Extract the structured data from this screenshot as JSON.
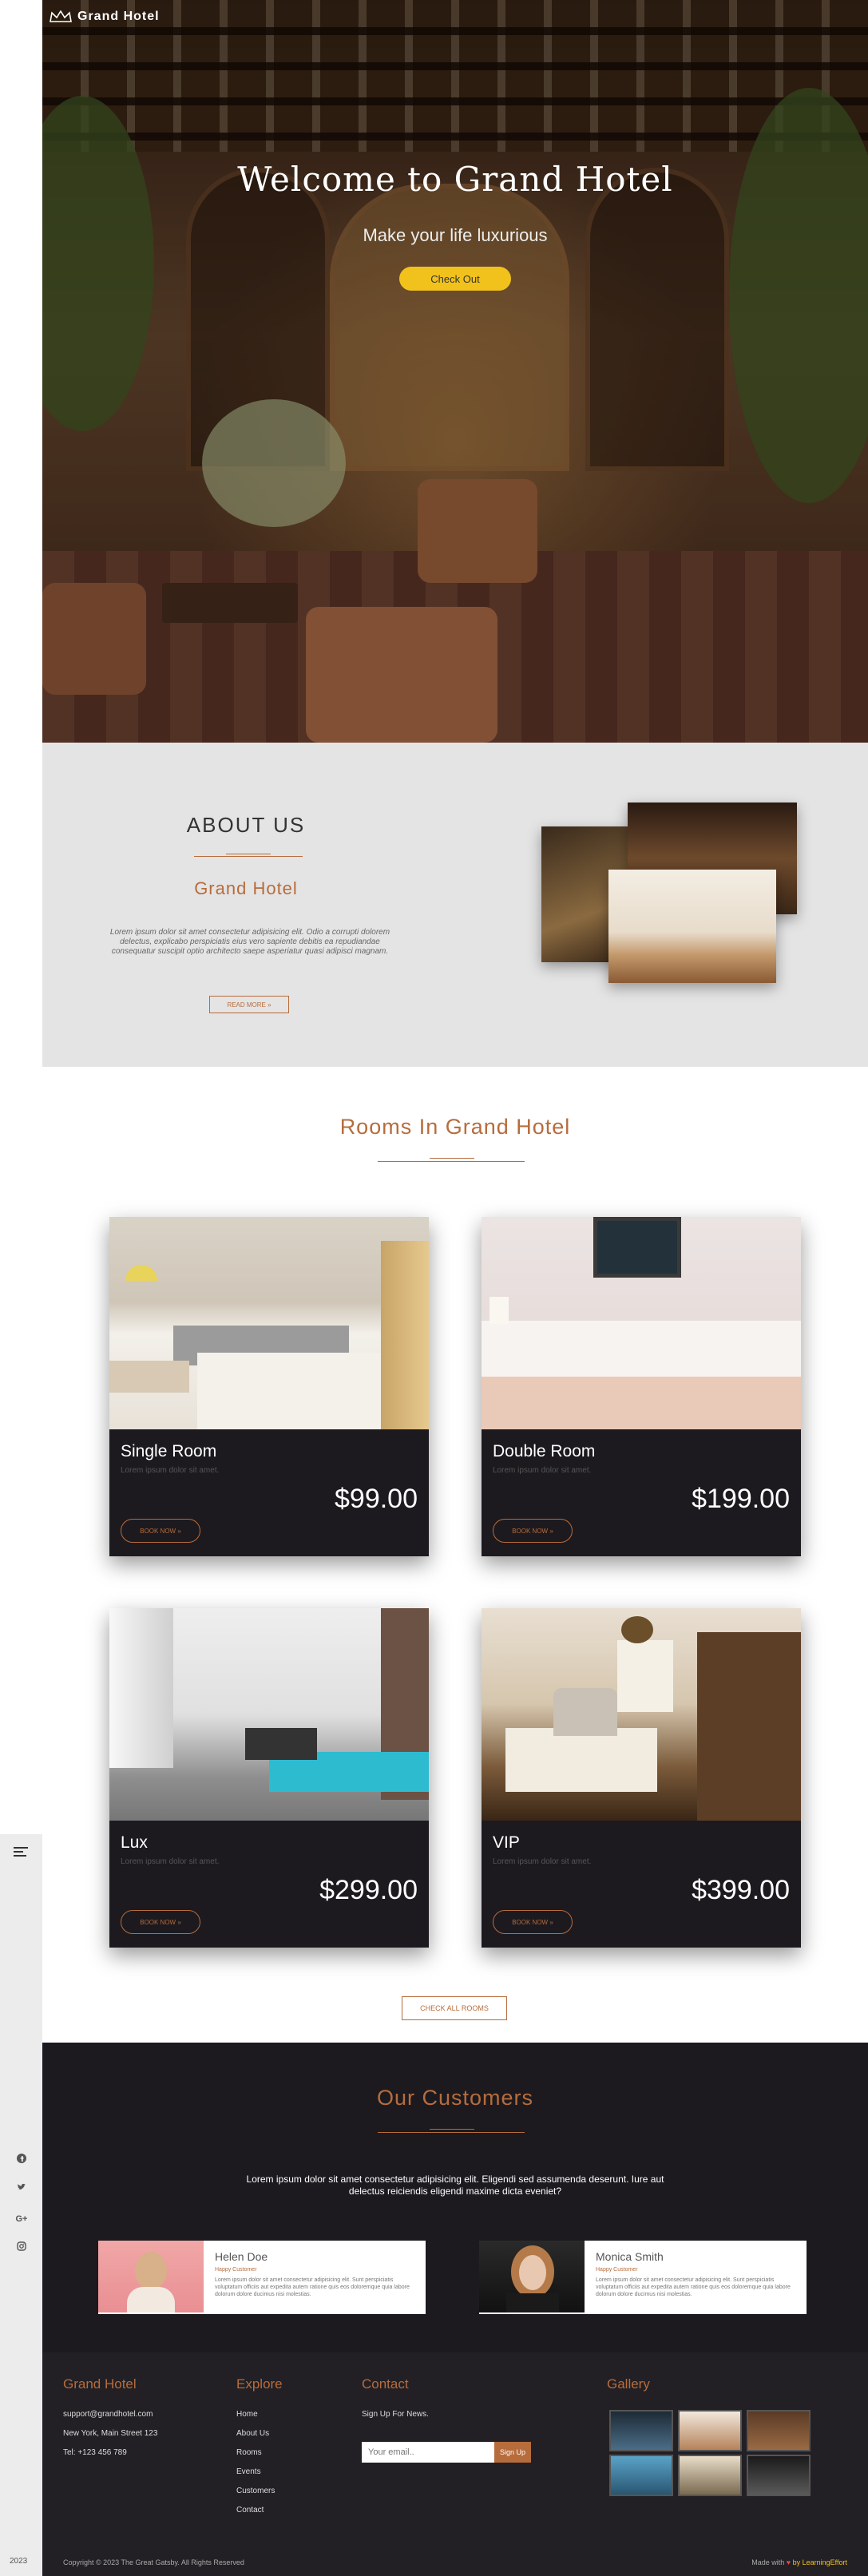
{
  "brand": {
    "name": "Grand Hotel"
  },
  "hero": {
    "title": "Welcome to Grand Hotel",
    "subtitle": "Make your life luxurious",
    "button": "Check Out"
  },
  "about": {
    "title": "ABOUT US",
    "hotel": "Grand Hotel",
    "text": "Lorem ipsum dolor sit amet consectetur adipisicing elit. Odio a corrupti dolorem delectus, explicabo perspiciatis eius vero sapiente debitis ea repudiandae consequatur suscipit optio architecto saepe asperiatur quasi adipisci magnam.",
    "read_more": "READ MORE »"
  },
  "rooms": {
    "title": "Rooms In Grand Hotel",
    "items": [
      {
        "name": "Single Room",
        "desc": "Lorem ipsum dolor sit amet.",
        "price": "$99.00",
        "book": "BOOK NOW »"
      },
      {
        "name": "Double Room",
        "desc": "Lorem ipsum dolor sit amet.",
        "price": "$199.00",
        "book": "BOOK NOW »"
      },
      {
        "name": "Lux",
        "desc": "Lorem ipsum dolor sit amet.",
        "price": "$299.00",
        "book": "BOOK NOW »"
      },
      {
        "name": "VIP",
        "desc": "Lorem ipsum dolor sit amet.",
        "price": "$399.00",
        "book": "BOOK NOW »"
      }
    ],
    "check_all": "CHECK ALL ROOMS"
  },
  "customers": {
    "title": "Our Customers",
    "text": "Lorem ipsum dolor sit amet consectetur adipisicing elit. Eligendi sed assumenda deserunt. Iure aut delectus reiciendis eligendi maxime dicta eveniet?",
    "testimonials": [
      {
        "name": "Helen Doe",
        "role": "Happy Customer",
        "text": "Lorem ipsum dolor sit amet consectetur adipisicing elit. Sunt perspiciatis voluptatum officiis aut expedita autem ratione quis eos doloremque quia labore dolorum dolore ducimus nisi molestias."
      },
      {
        "name": "Monica Smith",
        "role": "Happy Customer",
        "text": "Lorem ipsum dolor sit amet consectetur adipisicing elit. Sunt perspiciatis voluptatum officiis aut expedita autem ratione quis eos doloremque quia labore dolorum dolore ducimus nisi molestias."
      }
    ]
  },
  "footer": {
    "col1": {
      "title": "Grand Hotel",
      "email": "support@grandhotel.com",
      "address": "New York, Main Street 123",
      "phone": "Tel: +123 456 789"
    },
    "col2": {
      "title": "Explore",
      "links": [
        "Home",
        "About Us",
        "Rooms",
        "Events",
        "Customers",
        "Contact"
      ]
    },
    "col3": {
      "title": "Contact",
      "signup": "Sign Up For News.",
      "email_placeholder": "Your email..",
      "button": "Sign Up"
    },
    "col4": {
      "title": "Gallery"
    },
    "copyright": "Copyright © 2023 The Great Gatsby. All Rights Reserved",
    "made_with": "Made with",
    "made_by": "by LearningEffort"
  },
  "rail": {
    "year": "2023",
    "social_icons": [
      "facebook-icon",
      "twitter-icon",
      "google-plus-icon",
      "instagram-icon"
    ]
  },
  "colors": {
    "accent": "#b76c3c",
    "hero_button": "#f2c21c",
    "dark": "#1c1a1f",
    "about_bg": "#e4e4e4"
  }
}
